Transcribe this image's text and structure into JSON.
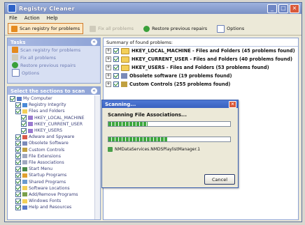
{
  "window": {
    "title": "Registry Cleaner"
  },
  "menu": [
    "File",
    "Action",
    "Help"
  ],
  "toolbar": {
    "scan_label": "Scan registry for problems",
    "fix_label": "Fix all problems",
    "restore_label": "Restore previous repairs",
    "options_label": "Options"
  },
  "tasks": {
    "heading": "Tasks",
    "items": [
      "Scan registry for problems",
      "Fix all problems",
      "Restore previous repairs",
      "Options"
    ]
  },
  "sections": {
    "heading": "Select the sections to scan",
    "items": [
      "My Computer",
      "Registry Integrity",
      "Files and Folders",
      "HKEY_LOCAL_MACHINE",
      "HKEY_CURRENT_USER",
      "HKEY_USERS",
      "Adware and Spyware",
      "Obsolete Software",
      "Custom Controls",
      "File Extensions",
      "File Associations",
      "Start Menu",
      "Startup Programs",
      "Shared Programs",
      "Software Locations",
      "Add/Remove Programs",
      "Windows Fonts",
      "Help and Resources"
    ]
  },
  "summary": {
    "heading": "Summary of found problems:",
    "rows": [
      "HKEY_LOCAL_MACHINE - Files and Folders  (45 problems found)",
      "HKEY_CURRENT_USER - Files and Folders  (40 problems found)",
      "HKEY_USERS - Files and Folders  (53 problems found)",
      "Obsolete software  (19 problems found)",
      "Custom Controls  (255 problems found)"
    ]
  },
  "dialog": {
    "title": "Scanning...",
    "heading": "Scanning File Associations...",
    "progress1": 0.32,
    "progress2": 0.49,
    "current_item": "NMDataServices.NMDSPlaylistManager.1",
    "cancel_label": "Cancel"
  },
  "colors": {
    "accent": "#3a62c0",
    "progress": "#3ea83e"
  }
}
